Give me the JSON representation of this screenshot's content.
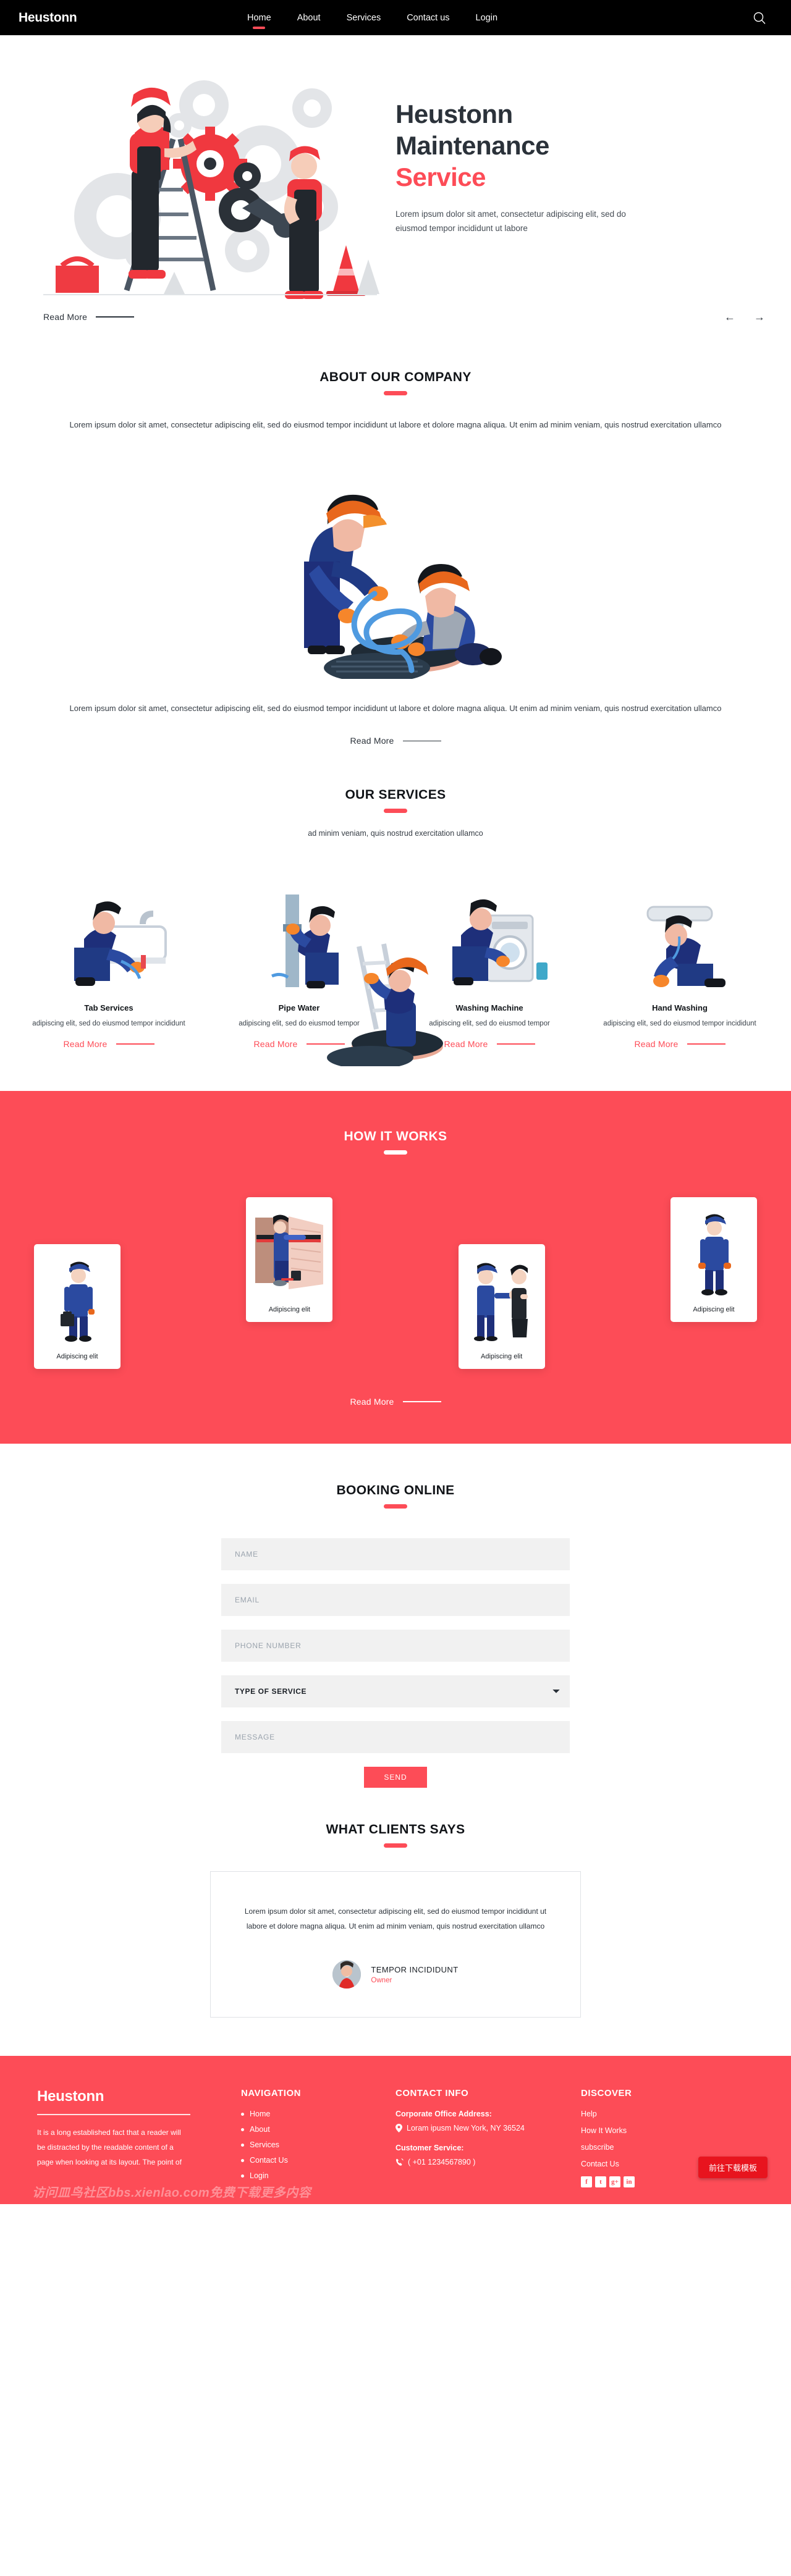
{
  "header": {
    "brand": "Heustonn",
    "nav": [
      {
        "label": "Home",
        "active": true
      },
      {
        "label": "About",
        "active": false
      },
      {
        "label": "Services",
        "active": false
      },
      {
        "label": "Contact us",
        "active": false
      },
      {
        "label": "Login",
        "active": false
      }
    ],
    "search_icon": "search-icon"
  },
  "hero": {
    "title_line1": "Heustonn",
    "title_line2": "Maintenance",
    "title_accent": "Service",
    "paragraph": "Lorem ipsum dolor sit amet, consectetur adipiscing elit, sed do eiusmod tempor incididunt ut labore",
    "read_more": "Read More",
    "prev_icon": "arrow-left-icon",
    "next_icon": "arrow-right-icon"
  },
  "about": {
    "title": "ABOUT OUR COMPANY",
    "paragraph_top": "Lorem ipsum dolor sit amet, consectetur adipiscing elit, sed do eiusmod tempor incididunt ut labore et dolore magna aliqua. Ut enim ad minim veniam, quis nostrud exercitation ullamco",
    "paragraph_bottom": "Lorem ipsum dolor sit amet, consectetur adipiscing elit, sed do eiusmod tempor incididunt ut labore et dolore magna aliqua. Ut enim ad minim veniam, quis nostrud exercitation ullamco",
    "read_more": "Read More"
  },
  "services": {
    "title": "OUR SERVICES",
    "subtitle": "ad minim veniam, quis nostrud exercitation ullamco",
    "items": [
      {
        "title": "Tab Services",
        "desc": "adipiscing elit, sed do eiusmod tempor incididunt",
        "read_more": "Read More"
      },
      {
        "title": "Pipe Water",
        "desc": "adipiscing elit, sed do eiusmod tempor",
        "read_more": "Read More"
      },
      {
        "title": "Washing Machine",
        "desc": "adipiscing elit, sed do eiusmod tempor",
        "read_more": "Read More"
      },
      {
        "title": "Hand Washing",
        "desc": "adipiscing elit, sed do eiusmod tempor incididunt",
        "read_more": "Read More"
      }
    ]
  },
  "how_it_works": {
    "title": "HOW IT WORKS",
    "cards": [
      {
        "label": "Adipiscing elit"
      },
      {
        "label": "Adipiscing elit"
      },
      {
        "label": "Adipiscing elit"
      },
      {
        "label": "Adipiscing elit"
      }
    ],
    "read_more": "Read More"
  },
  "booking": {
    "title": "BOOKING ONLINE",
    "fields": {
      "name_placeholder": "NAME",
      "email_placeholder": "EMAIL",
      "phone_placeholder": "PHONE NUMBER",
      "service_selected": "TYPE OF SERVICE",
      "service_options": [
        "TYPE OF SERVICE"
      ],
      "message_placeholder": "MESSAGE"
    },
    "send_label": "SEND"
  },
  "testimonials": {
    "title": "WHAT CLIENTS SAYS",
    "quote": "Lorem ipsum dolor sit amet, consectetur adipiscing elit, sed do eiusmod tempor incididunt ut labore et dolore magna aliqua. Ut enim ad minim veniam, quis nostrud exercitation ullamco",
    "author_name": "TEMPOR INCIDIDUNT",
    "author_role": "Owner"
  },
  "footer": {
    "brand": "Heustonn",
    "brand_text": "It is a long established fact that a reader will be distracted by the readable content of a page when looking at its layout. The point of",
    "nav_heading": "NAVIGATION",
    "nav_items": [
      "Home",
      "About",
      "Services",
      "Contact Us",
      "Login"
    ],
    "contact_heading": "CONTACT INFO",
    "address_label": "Corporate Office Address:",
    "address_value": "Loram ipusm New York, NY 36524",
    "service_label": "Customer Service:",
    "service_value": "( +01 1234567890 )",
    "discover_heading": "DISCOVER",
    "discover_items": [
      "Help",
      "How It Works",
      "subscribe",
      "Contact Us"
    ],
    "socials": [
      {
        "name": "facebook-icon",
        "glyph": "f"
      },
      {
        "name": "twitter-icon",
        "glyph": "t"
      },
      {
        "name": "google-plus-icon",
        "glyph": "g+"
      },
      {
        "name": "linkedin-icon",
        "glyph": "in"
      }
    ],
    "download_badge": "前往下载模板",
    "watermark": "访问皿鸟社区bbs.xienlao.com免费下载更多内容"
  },
  "colors": {
    "accent": "#fd4c57",
    "dark": "#000000",
    "heading": "#111418",
    "field_bg": "#f1f1f1",
    "badge_red": "#e8141e"
  }
}
